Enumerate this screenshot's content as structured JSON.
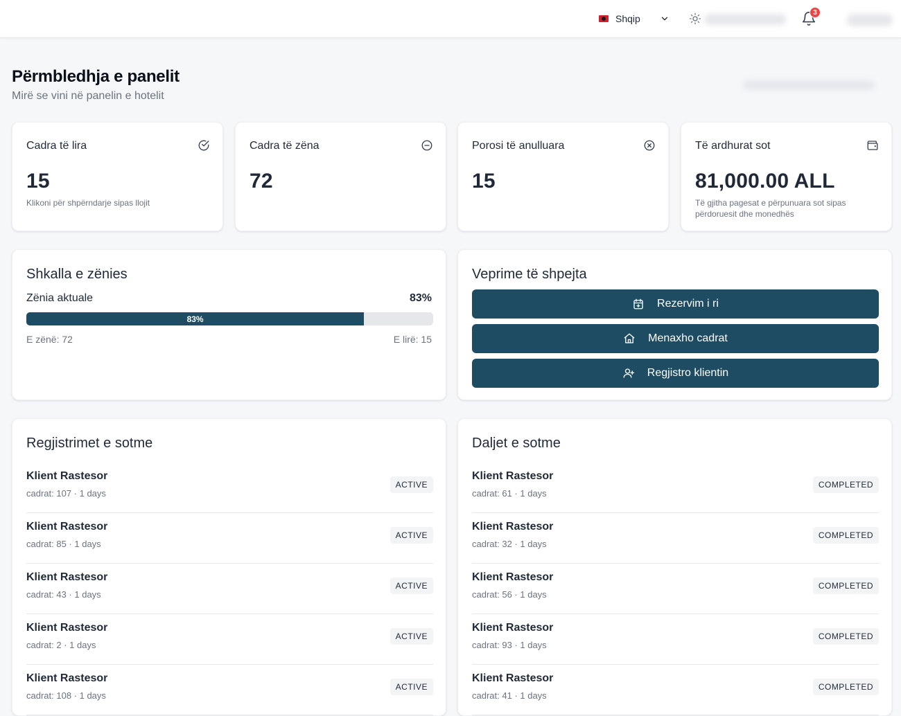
{
  "topbar": {
    "language": "Shqip",
    "notification_count": "3"
  },
  "header": {
    "title": "Përmbledhja e panelit",
    "subtitle": "Mirë se vini në panelin e hotelit"
  },
  "stats": [
    {
      "title": "Cadra të lira",
      "value": "15",
      "desc": "Klikoni për shpërndarje sipas llojit",
      "icon": "check-circle-icon"
    },
    {
      "title": "Cadra të zëna",
      "value": "72",
      "desc": "",
      "icon": "minus-circle-icon"
    },
    {
      "title": "Porosi të anulluara",
      "value": "15",
      "desc": "",
      "icon": "x-circle-icon"
    },
    {
      "title": "Të ardhurat sot",
      "value": "81,000.00 ALL",
      "desc": "Të gjitha pagesat e përpunuara sot sipas përdoruesit dhe monedhës",
      "icon": "wallet-icon"
    }
  ],
  "occupancy": {
    "title": "Shkalla e zënies",
    "label": "Zënia aktuale",
    "percent_text": "83%",
    "percent": 83,
    "busy": "E zënë: 72",
    "free": "E lirë: 15"
  },
  "quick_actions": {
    "title": "Veprime të shpejta",
    "buttons": [
      "Rezervim i ri",
      "Menaxho cadrat",
      "Regjistro klientin"
    ]
  },
  "checkins": {
    "title": "Regjistrimet e sotme",
    "items": [
      {
        "name": "Klient Rastesor",
        "meta": "cadrat: 107 · 1 days",
        "status": "ACTIVE"
      },
      {
        "name": "Klient Rastesor",
        "meta": "cadrat: 85 · 1 days",
        "status": "ACTIVE"
      },
      {
        "name": "Klient Rastesor",
        "meta": "cadrat: 43 · 1 days",
        "status": "ACTIVE"
      },
      {
        "name": "Klient Rastesor",
        "meta": "cadrat: 2 · 1 days",
        "status": "ACTIVE"
      },
      {
        "name": "Klient Rastesor",
        "meta": "cadrat: 108 · 1 days",
        "status": "ACTIVE"
      }
    ]
  },
  "checkouts": {
    "title": "Daljet e sotme",
    "items": [
      {
        "name": "Klient Rastesor",
        "meta": "cadrat: 61 · 1 days",
        "status": "COMPLETED"
      },
      {
        "name": "Klient Rastesor",
        "meta": "cadrat: 32 · 1 days",
        "status": "COMPLETED"
      },
      {
        "name": "Klient Rastesor",
        "meta": "cadrat: 56 · 1 days",
        "status": "COMPLETED"
      },
      {
        "name": "Klient Rastesor",
        "meta": "cadrat: 93 · 1 days",
        "status": "COMPLETED"
      },
      {
        "name": "Klient Rastesor",
        "meta": "cadrat: 41 · 1 days",
        "status": "COMPLETED"
      }
    ]
  },
  "colors": {
    "primary": "#1d4c63",
    "badge": "#ef4444"
  }
}
